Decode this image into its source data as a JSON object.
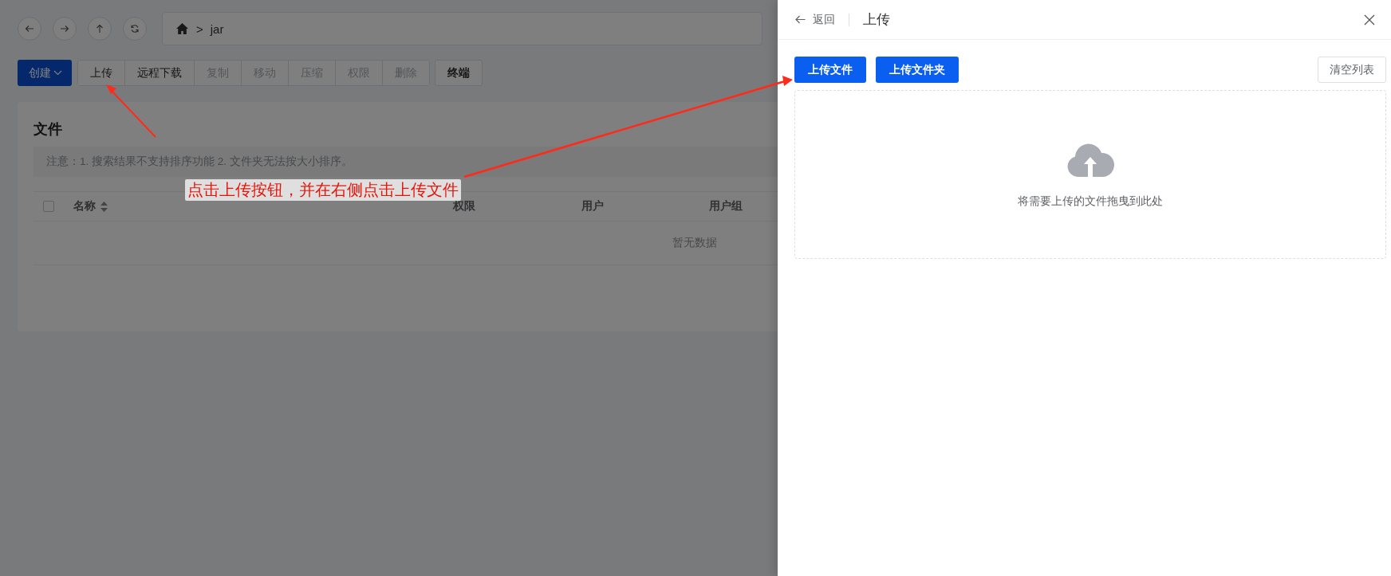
{
  "path_bar": {
    "separator": ">",
    "segments": [
      "jar"
    ]
  },
  "toolbar": {
    "create": {
      "label": "创建"
    },
    "buttons": [
      {
        "label": "上传",
        "disabled": false
      },
      {
        "label": "远程下载",
        "disabled": false
      },
      {
        "label": "复制",
        "disabled": true
      },
      {
        "label": "移动",
        "disabled": true
      },
      {
        "label": "压缩",
        "disabled": true
      },
      {
        "label": "权限",
        "disabled": true
      },
      {
        "label": "删除",
        "disabled": true
      }
    ],
    "terminal": {
      "label": "终端"
    }
  },
  "files_card": {
    "title": "文件",
    "notice": "注意：1. 搜索结果不支持排序功能 2. 文件夹无法按大小排序。",
    "columns": [
      {
        "label": "名称",
        "sortable": true
      },
      {
        "label": "权限",
        "sortable": false
      },
      {
        "label": "用户",
        "sortable": false
      },
      {
        "label": "用户组",
        "sortable": false
      }
    ],
    "select_all": {
      "checked": false
    },
    "empty_text": "暂无数据"
  },
  "annotation": {
    "text": "点击上传按钮，并在右侧点击上传文件"
  },
  "drawer": {
    "back_label": "返回",
    "title": "上传",
    "buttons": [
      {
        "label": "上传文件"
      },
      {
        "label": "上传文件夹"
      }
    ],
    "clear_button": {
      "label": "清空列表"
    },
    "dropzone_text": "将需要上传的文件拖曳到此处"
  }
}
